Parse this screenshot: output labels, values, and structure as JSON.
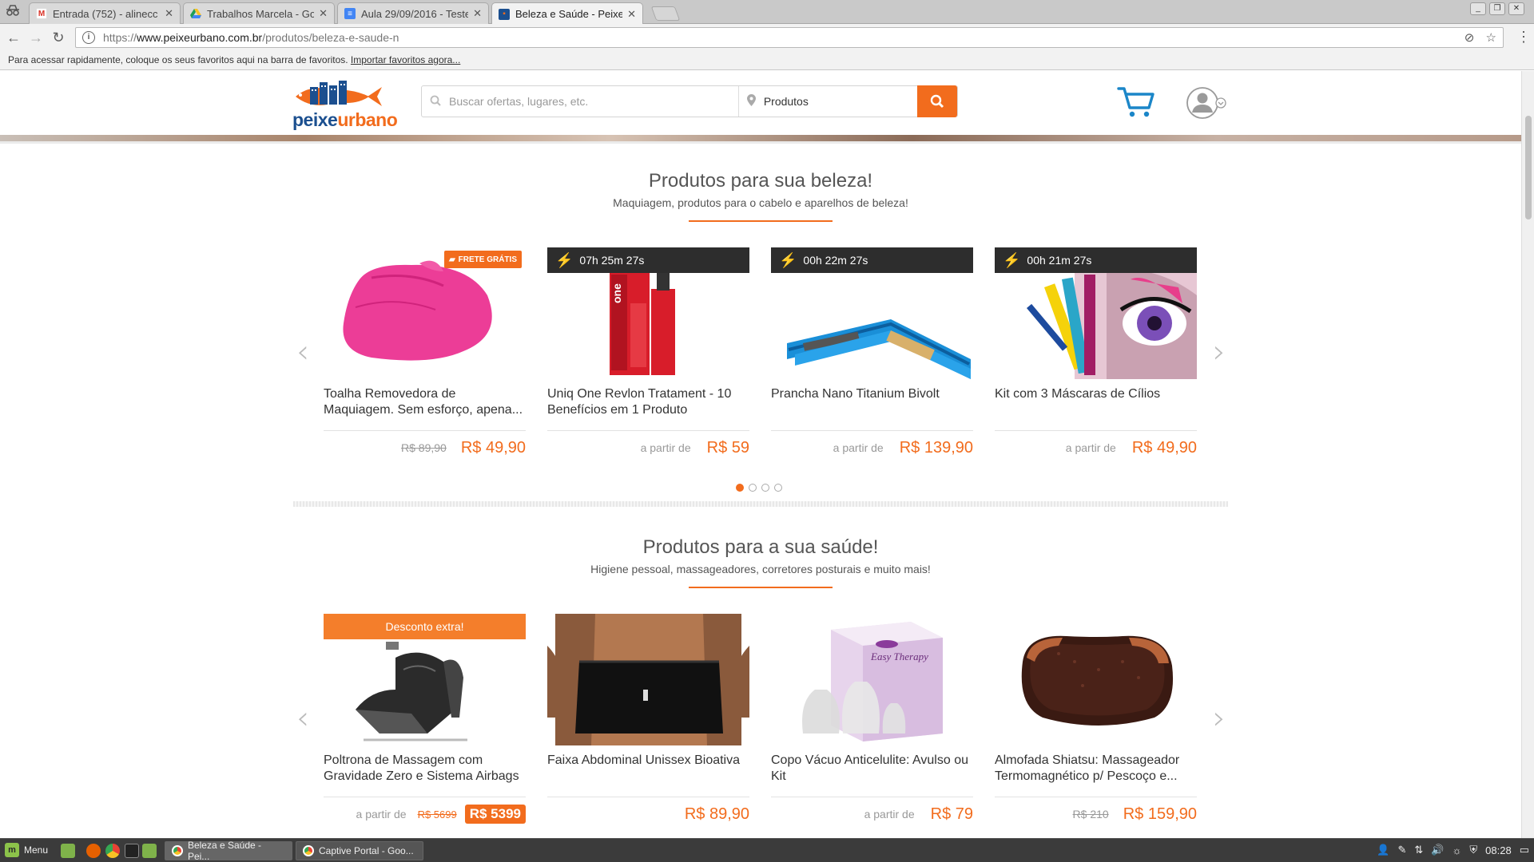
{
  "browser": {
    "tabs": [
      {
        "title": "Entrada (752) - alinecc",
        "favicon": "gmail-icon"
      },
      {
        "title": "Trabalhos Marcela - Go",
        "favicon": "drive-icon"
      },
      {
        "title": "Aula 29/09/2016 - Teste",
        "favicon": "docs-icon"
      },
      {
        "title": "Beleza e Saúde - Peixe U",
        "favicon": "peixe-icon",
        "active": true
      }
    ],
    "url": {
      "scheme": "https://",
      "host": "www.peixeurbano.com.br",
      "path": "/produtos/beleza-e-saude-n"
    },
    "bookmarks_text": "Para acessar rapidamente, coloque os seus favoritos aqui na barra de favoritos.",
    "bookmarks_link": "Importar favoritos agora..."
  },
  "header": {
    "logo_part1": "peixe",
    "logo_part2": "urbano",
    "search_placeholder": "Buscar ofertas, lugares, etc.",
    "location_value": "Produtos"
  },
  "beauty": {
    "title": "Produtos para sua beleza!",
    "subtitle": "Maquiagem, produtos para o cabelo e aparelhos de beleza!",
    "products": [
      {
        "name": "Toalha Removedora de Maquiagem. Sem esforço, apena...",
        "badge": "FRETE GRÁTIS",
        "old_price": "R$ 89,90",
        "price": "R$ 49,90"
      },
      {
        "name": "Uniq One Revlon Tratament - 10 Benefícios em 1 Produto",
        "timer": "07h 25m 27s",
        "from_label": "a partir de",
        "price": "R$ 59"
      },
      {
        "name": "Prancha Nano Titanium Bivolt",
        "timer": "00h 22m 27s",
        "from_label": "a partir de",
        "price": "R$ 139,90"
      },
      {
        "name": "Kit com 3 Máscaras de Cílios",
        "timer": "00h 21m 27s",
        "from_label": "a partir de",
        "price": "R$ 49,90"
      }
    ],
    "page_dots": 4,
    "active_dot": 1
  },
  "health": {
    "title": "Produtos para a sua saúde!",
    "subtitle": "Higiene pessoal, massageadores, corretores posturais e muito mais!",
    "products": [
      {
        "name": "Poltrona de Massagem com Gravidade Zero e Sistema Airbags",
        "badge": "Desconto extra!",
        "from_label": "a partir de",
        "old_price": "R$ 5699",
        "price": "R$ 5399"
      },
      {
        "name": "Faixa Abdominal Unissex Bioativa",
        "price": "R$ 89,90"
      },
      {
        "name": "Copo Vácuo Anticelulite: Avulso ou Kit",
        "from_label": "a partir de",
        "price": "R$ 79"
      },
      {
        "name": "Almofada Shiatsu: Massageador Termomagnético p/ Pescoço e...",
        "old_price": "R$ 210",
        "price": "R$ 159,90"
      }
    ]
  },
  "taskbar": {
    "menu_label": "Menu",
    "windows": [
      {
        "title": "Beleza e Saúde - Pei..."
      },
      {
        "title": "Captive Portal - Goo..."
      }
    ],
    "clock": "08:28"
  },
  "colors": {
    "accent": "#f26c1d",
    "brand_blue": "#1b4f8f",
    "timer_bg": "#2d2d2d"
  }
}
